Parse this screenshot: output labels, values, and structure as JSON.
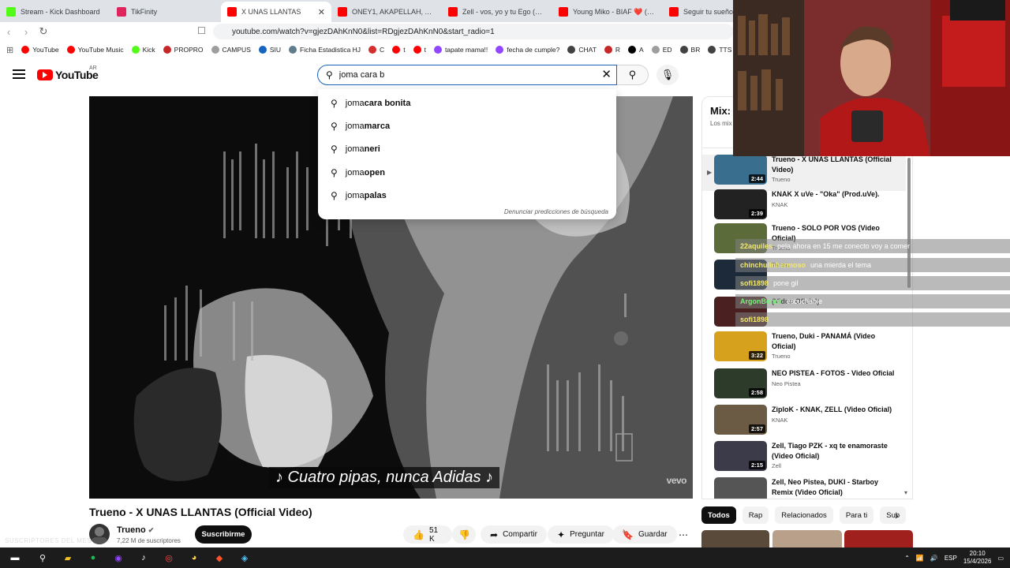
{
  "browser": {
    "tabs": [
      {
        "title": "Stream - Kick Dashboard",
        "color": "#53fc18",
        "active": false
      },
      {
        "title": "TikFinity",
        "color": "#e0245e",
        "active": false
      },
      {
        "title": "X UNAS LLANTAS",
        "color": "#ff0000",
        "active": true
      },
      {
        "title": "ONEY1, AKAPELLAH, ARA - El",
        "color": "#ff0000",
        "active": false
      },
      {
        "title": "Zell - vos, yo y tu Ego (Video",
        "color": "#ff0000",
        "active": false
      },
      {
        "title": "Young Miko - BIAF ❤️ (Video",
        "color": "#ff0000",
        "active": false
      },
      {
        "title": "Seguir tu sueño es",
        "color": "#ff0000",
        "active": false
      }
    ],
    "url": "youtube.com/watch?v=gjezDAhKnN0&list=RDgjezDAhKnN0&start_radio=1",
    "bookmarks": [
      {
        "label": "YouTube",
        "color": "#ff0000"
      },
      {
        "label": "YouTube Music",
        "color": "#ff0000"
      },
      {
        "label": "Kick",
        "color": "#53fc18"
      },
      {
        "label": "PROPRO",
        "color": "#c62828"
      },
      {
        "label": "CAMPUS",
        "color": "#9e9e9e"
      },
      {
        "label": "SIU",
        "color": "#1565c0"
      },
      {
        "label": "Ficha Estadistica HJ",
        "color": "#607d8b"
      },
      {
        "label": "C",
        "color": "#d32f2f"
      },
      {
        "label": "t",
        "color": "#ff0000"
      },
      {
        "label": "t",
        "color": "#ff0000"
      },
      {
        "label": "tapate mama!!",
        "color": "#9146ff"
      },
      {
        "label": "fecha de cumple?",
        "color": "#9146ff"
      },
      {
        "label": "CHAT",
        "color": "#424242"
      },
      {
        "label": "R",
        "color": "#c62828"
      },
      {
        "label": "A",
        "color": "#000000"
      },
      {
        "label": "ED",
        "color": "#9e9e9e"
      },
      {
        "label": "BR",
        "color": "#424242"
      },
      {
        "label": "TTS",
        "color": "#424242"
      }
    ]
  },
  "youtube": {
    "logo": "YouTube",
    "country": "AR",
    "search_value": "joma cara b",
    "suggestions": [
      {
        "prefix": "joma ",
        "rest": "cara bonita",
        "typed": "cara "
      },
      {
        "prefix": "joma ",
        "rest": "marca",
        "typed": ""
      },
      {
        "prefix": "joma ",
        "rest": "neri",
        "typed": ""
      },
      {
        "prefix": "joma ",
        "rest": "open",
        "typed": ""
      },
      {
        "prefix": "joma ",
        "rest": "palas",
        "typed": ""
      }
    ],
    "report_predictions": "Denunciar predicciones de búsqueda"
  },
  "video": {
    "caption": "♪ Cuatro pipas, nunca Adidas ♪",
    "watermark": "vevo",
    "title": "Trueno - X UNAS LLANTAS (Official Video)",
    "channel": "Trueno",
    "subscribers": "7,22 M de suscriptores",
    "subscribe_label": "Suscribirme",
    "likes": "51 K",
    "share_label": "Compartir",
    "ask_label": "Preguntar",
    "save_label": "Guardar"
  },
  "mix": {
    "title": "Mix:",
    "subtitle": "Los mix"
  },
  "playlist": [
    {
      "title": "Trueno - X UNAS LLANTAS (Official Video)",
      "channel": "Trueno",
      "duration": "2:44",
      "current": true,
      "thumb": "#3a6e8f"
    },
    {
      "title": "KNAK X uVe - \"Oka\" (Prod.uVe).",
      "channel": "KNAK",
      "duration": "2:39",
      "current": false,
      "thumb": "#222222"
    },
    {
      "title": "Trueno - SOLO POR VOS (Video Oficial)",
      "channel": "Trueno",
      "duration": "",
      "current": false,
      "thumb": "#5b6b3a"
    },
    {
      "title": "",
      "channel": "Trueno",
      "duration": "",
      "current": false,
      "thumb": "#1c2a3a"
    },
    {
      "title": "(Video Oficial)",
      "channel": "",
      "duration": "",
      "current": false,
      "thumb": "#4a2020"
    },
    {
      "title": "Trueno, Duki - PANAMÁ (Video Oficial)",
      "channel": "Trueno",
      "duration": "3:22",
      "current": false,
      "thumb": "#d6a21e"
    },
    {
      "title": "NEO PISTEA - FOTOS - Video Oficial",
      "channel": "Neo Pistea",
      "duration": "2:58",
      "current": false,
      "thumb": "#2d3b2a"
    },
    {
      "title": "ZiploK - KNAK, ZELL (Video Oficial)",
      "channel": "KNAK",
      "duration": "2:57",
      "current": false,
      "thumb": "#6b5a44"
    },
    {
      "title": "Zell, Tiago PZK - xq te enamoraste (Video Oficial)",
      "channel": "Zell",
      "duration": "2:15",
      "current": false,
      "thumb": "#3b3b4a"
    },
    {
      "title": "Zell, Neo Pistea, DUKI - Starboy Remix (Video Oficial)",
      "channel": "",
      "duration": "",
      "current": false,
      "thumb": "#555555"
    }
  ],
  "chat": [
    {
      "user": "22aquiles",
      "user_color": "#f3e96b",
      "msg": "pela ahora en 15 me conecto voy a comer"
    },
    {
      "user": "chinchulinhermoso",
      "user_color": "#f3e96b",
      "msg": "una mierda el tema"
    },
    {
      "user": "sofi1898",
      "user_color": "#f3e96b",
      "msg": "pone gil"
    },
    {
      "user": "ArgonBenur",
      "user_color": "#7cf07c",
      "msg": "escuchable"
    },
    {
      "user": "sofi1898",
      "user_color": "#f3e96b",
      "msg": ""
    }
  ],
  "chips": [
    {
      "label": "Todos",
      "on": true
    },
    {
      "label": "Rap",
      "on": false
    },
    {
      "label": "Relacionados",
      "on": false
    },
    {
      "label": "Para ti",
      "on": false
    },
    {
      "label": "Sub",
      "on": false
    }
  ],
  "taskbar": {
    "lang": "ESP",
    "time": "20:10",
    "date": "15/4/2026"
  },
  "overlay": {
    "watermark": "SUSCRIPTORES DEL MES"
  }
}
